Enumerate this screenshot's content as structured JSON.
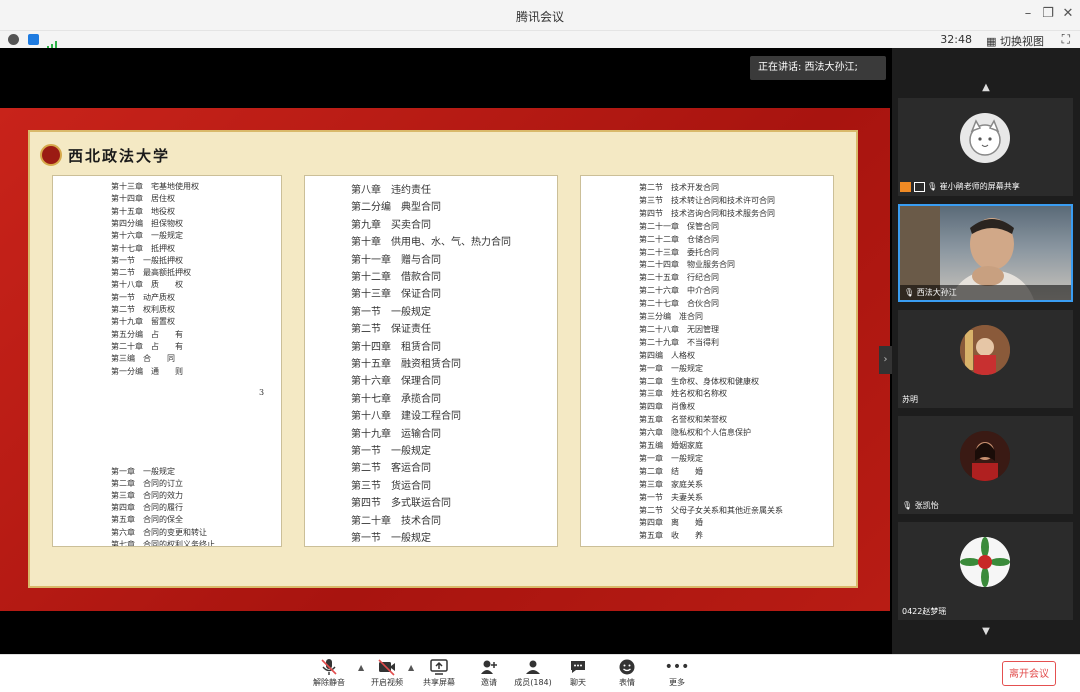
{
  "window": {
    "title": "腾讯会议"
  },
  "infobar": {
    "timer": "32:48",
    "switch_view": "切换视图"
  },
  "speaker": {
    "text": "正在讲话: 西法大孙江;"
  },
  "slide": {
    "logo_text": "西北政法大学",
    "page1": {
      "top_lines": [
        "第十三章　宅基地使用权",
        "第十四章　居住权",
        "第十五章　地役权",
        "第四分编　担保物权",
        "第十六章　一般规定",
        "第十七章　抵押权",
        "第一节　一般抵押权",
        "第二节　最高额抵押权",
        "第十八章　质　　权",
        "第一节　动产质权",
        "第二节　权利质权",
        "第十九章　留置权",
        "第五分编　占　　有",
        "第二十章　占　　有",
        "第三编　合　　同",
        "第一分编　通　　则"
      ],
      "page_number": "3",
      "bottom_lines": [
        "第一章　一般规定",
        "第二章　合同的订立",
        "第三章　合同的效力",
        "第四章　合同的履行",
        "第五章　合同的保全",
        "第六章　合同的变更和转让",
        "第七章　合同的权利义务终止"
      ]
    },
    "page2": {
      "lines": [
        "第八章　违约责任",
        "第二分编　典型合同",
        "第九章　买卖合同",
        "第十章　供用电、水、气、热力合同",
        "第十一章　赠与合同",
        "第十二章　借款合同",
        "第十三章　保证合同",
        "第一节　一般规定",
        "第二节　保证责任",
        "第十四章　租赁合同",
        "第十五章　融资租赁合同",
        "第十六章　保理合同",
        "第十七章　承揽合同",
        "第十八章　建设工程合同",
        "第十九章　运输合同",
        "第一节　一般规定",
        "第二节　客运合同",
        "第三节　货运合同",
        "第四节　多式联运合同",
        "第二十章　技术合同",
        "第一节　一般规定"
      ]
    },
    "page3": {
      "lines": [
        "第二节　技术开发合同",
        "第三节　技术转让合同和技术许可合同",
        "第四节　技术咨询合同和技术服务合同",
        "第二十一章　保管合同",
        "第二十二章　仓储合同",
        "第二十三章　委托合同",
        "第二十四章　物业服务合同",
        "第二十五章　行纪合同",
        "第二十六章　中介合同",
        "第二十七章　合伙合同",
        "第三分编　准合同",
        "第二十八章　无因管理",
        "第二十九章　不当得利",
        "第四编　人格权",
        "第一章　一般规定",
        "第二章　生命权、身体权和健康权",
        "第三章　姓名权和名称权",
        "第四章　肖像权",
        "第五章　名誉权和荣誉权",
        "第六章　隐私权和个人信息保护",
        "第五编　婚姻家庭",
        "第一章　一般规定",
        "第二章　结　　婚",
        "第三章　家庭关系",
        "第一节　夫妻关系",
        "第二节　父母子女关系和其他近亲属关系",
        "第四章　离　　婚",
        "第五章　收　　养"
      ]
    }
  },
  "participants": [
    {
      "name": "崔小鹃老师的屏幕共享"
    },
    {
      "name": "西法大孙江"
    },
    {
      "name": "苏明"
    },
    {
      "name": "张凯怡"
    },
    {
      "name": "0422赵梦瑶"
    }
  ],
  "toolbar": {
    "mute": "解除静音",
    "video": "开启视频",
    "share": "共享屏幕",
    "invite": "邀请",
    "members": "成员(184)",
    "chat": "聊天",
    "reactions": "表情",
    "more": "更多",
    "leave": "离开会议"
  },
  "colors": {
    "accent": "#3a9df2",
    "leave": "#e24c4c",
    "slide_red": "#b81c14",
    "paper": "#f4e9c4"
  }
}
